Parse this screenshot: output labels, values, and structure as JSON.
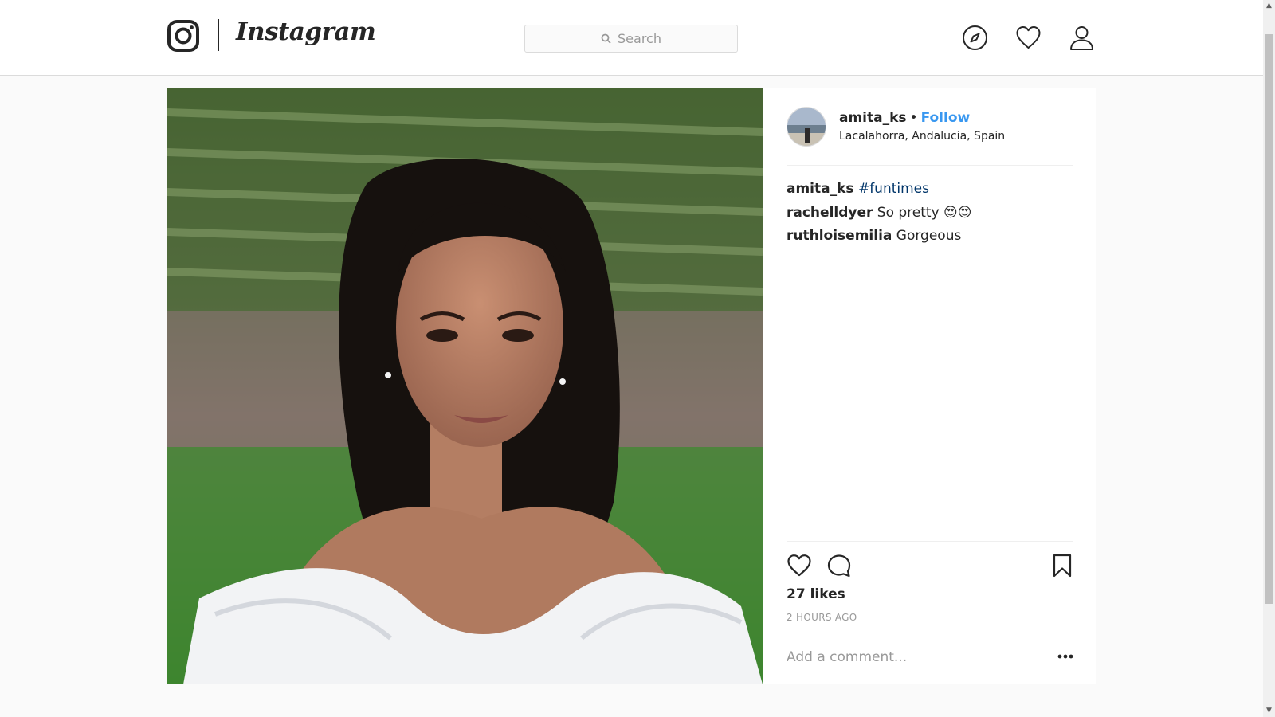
{
  "header": {
    "brand": "Instagram",
    "search_placeholder": "Search",
    "icons": [
      "instagram-glyph-icon",
      "search-icon",
      "compass-icon",
      "heart-icon",
      "person-icon"
    ]
  },
  "post": {
    "author": {
      "username": "amita_ks",
      "separator": "•",
      "follow_label": "Follow",
      "location": "Lacalahorra, Andalucia, Spain"
    },
    "caption": {
      "user": "amita_ks",
      "text": "#funtimes"
    },
    "comments": [
      {
        "user": "rachelldyer",
        "text": "So pretty 😍😍"
      },
      {
        "user": "ruthloisemilia",
        "text": "Gorgeous"
      }
    ],
    "likes": "27 likes",
    "timestamp": "2 HOURS AGO",
    "add_comment_placeholder": "Add a comment...",
    "colors": {
      "link": "#3897f0",
      "hashtag": "#003569",
      "muted": "#999999"
    }
  }
}
